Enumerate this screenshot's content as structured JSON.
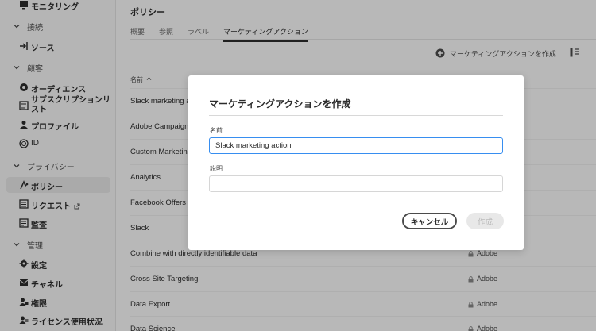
{
  "sidebar": {
    "items": [
      {
        "label": "モニタリング",
        "icon": "monitoring-icon"
      },
      {
        "label": "ソース",
        "icon": "source-icon"
      },
      {
        "label": "オーディエンス",
        "icon": "audience-icon"
      },
      {
        "label": "サブスクリプションリスト",
        "icon": "subscription-list-icon"
      },
      {
        "label": "プロファイル",
        "icon": "profile-icon"
      },
      {
        "label": "ID",
        "icon": "identity-icon"
      },
      {
        "label": "ポリシー",
        "icon": "policy-icon"
      },
      {
        "label": "リクエスト",
        "icon": "request-icon"
      },
      {
        "label": "監査",
        "icon": "audit-icon"
      },
      {
        "label": "設定",
        "icon": "settings-icon"
      },
      {
        "label": "チャネル",
        "icon": "channel-icon"
      },
      {
        "label": "権限",
        "icon": "permissions-icon"
      },
      {
        "label": "ライセンス使用状況",
        "icon": "license-icon"
      }
    ],
    "sections": [
      "接続",
      "顧客",
      "プライバシー",
      "管理"
    ]
  },
  "main": {
    "title": "ポリシー",
    "tabs": [
      "概要",
      "参照",
      "ラベル",
      "マーケティングアクション"
    ],
    "create_button": "マーケティングアクションを作成",
    "column_name": "名前",
    "rows": [
      {
        "name": "Slack marketing action",
        "source": ""
      },
      {
        "name": "Adobe Campaign",
        "source": ""
      },
      {
        "name": "Custom Marketing Action",
        "source": ""
      },
      {
        "name": "Analytics",
        "source": ""
      },
      {
        "name": "Facebook Offers",
        "source": ""
      },
      {
        "name": "Slack",
        "source": ""
      },
      {
        "name": "Combine with directly identifiable data",
        "source": "Adobe"
      },
      {
        "name": "Cross Site Targeting",
        "source": "Adobe"
      },
      {
        "name": "Data Export",
        "source": "Adobe"
      },
      {
        "name": "Data Science",
        "source": "Adobe"
      }
    ]
  },
  "dialog": {
    "title": "マーケティングアクションを作成",
    "name_label": "名前",
    "name_value": "Slack marketing action",
    "description_label": "説明",
    "description_value": "",
    "cancel_label": "キャンセル",
    "create_label": "作成"
  }
}
